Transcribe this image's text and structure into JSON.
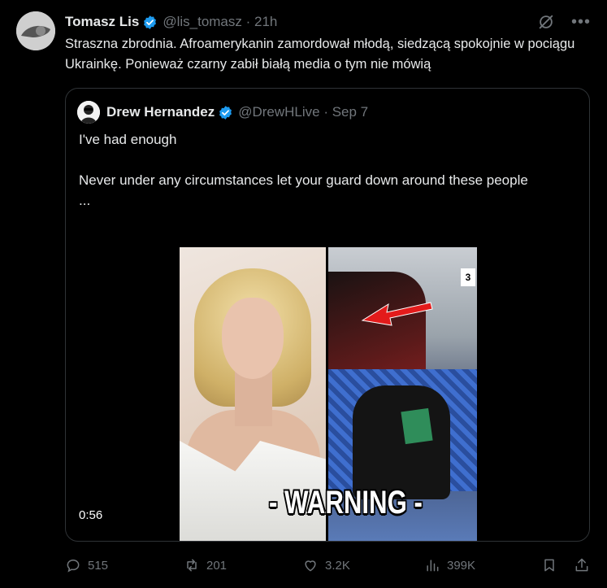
{
  "tweet": {
    "author_name": "Tomasz Lis",
    "handle": "@lis_tomasz · 21h",
    "text": "Straszna zbrodnia. Afroamerykanin zamordował młodą, siedzącą spokojnie w pociągu  Ukrainkę. Ponieważ czarny zabił białą media o tym nie mówią"
  },
  "quote": {
    "author_name": "Drew Hernandez",
    "handle": "@DrewHLive · Sep 7",
    "text": "I've had enough\n\nNever under any circumstances let your guard down around these people\n...",
    "media": {
      "overlay_text": "- WARNING -",
      "duration": "0:56",
      "channel_logo": "3"
    }
  },
  "actions": {
    "replies": "515",
    "retweets": "201",
    "likes": "3.2K",
    "views": "399K"
  },
  "icons": [
    "verified-badge-icon",
    "grok-icon",
    "more-icon",
    "reply-icon",
    "retweet-icon",
    "like-icon",
    "views-icon",
    "bookmark-icon",
    "share-icon"
  ],
  "colors": {
    "background": "#000000",
    "text": "#e7e9ea",
    "muted": "#71767b",
    "border": "#2f3336",
    "verified": "#1d9bf0"
  }
}
